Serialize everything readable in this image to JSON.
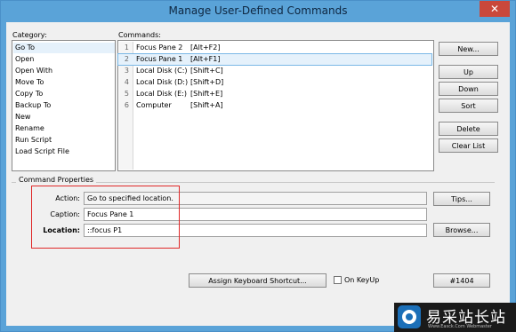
{
  "window": {
    "title": "Manage User-Defined Commands",
    "close_glyph": "✕"
  },
  "category": {
    "label": "Category:",
    "items": [
      "Go To",
      "Open",
      "Open With",
      "Move To",
      "Copy To",
      "Backup To",
      "New",
      "Rename",
      "Run Script",
      "Load Script File"
    ]
  },
  "commands": {
    "label": "Commands:",
    "rows": [
      {
        "n": "1",
        "name": "Focus Pane 2",
        "key": "[Alt+F2]"
      },
      {
        "n": "2",
        "name": "Focus Pane 1",
        "key": "[Alt+F1]"
      },
      {
        "n": "3",
        "name": "Local Disk (C:)",
        "key": "[Shift+C]"
      },
      {
        "n": "4",
        "name": "Local Disk (D:)",
        "key": "[Shift+D]"
      },
      {
        "n": "5",
        "name": "Local Disk (E:)",
        "key": "[Shift+E]"
      },
      {
        "n": "6",
        "name": "Computer",
        "key": "[Shift+A]"
      }
    ]
  },
  "buttons": {
    "new": "New...",
    "up": "Up",
    "down": "Down",
    "sort": "Sort",
    "delete": "Delete",
    "clear": "Clear List",
    "tips": "Tips...",
    "browse": "Browse...",
    "assign": "Assign Keyboard Shortcut...",
    "id": "#1404"
  },
  "properties": {
    "group_label": "Command Properties",
    "action_label": "Action:",
    "action_value": "Go to specified location.",
    "caption_label": "Caption:",
    "caption_value": "Focus Pane 1",
    "location_label": "Location:",
    "location_value": "::focus P1"
  },
  "on_keyup_label": "On KeyUp",
  "watermark": {
    "main": "易采站长站",
    "sub": "Www.Easck.Com Webmaster"
  },
  "colors": {
    "titlebar": "#5aa3d8",
    "selection": "#e5f1fb",
    "highlight_box": "#e02828"
  }
}
